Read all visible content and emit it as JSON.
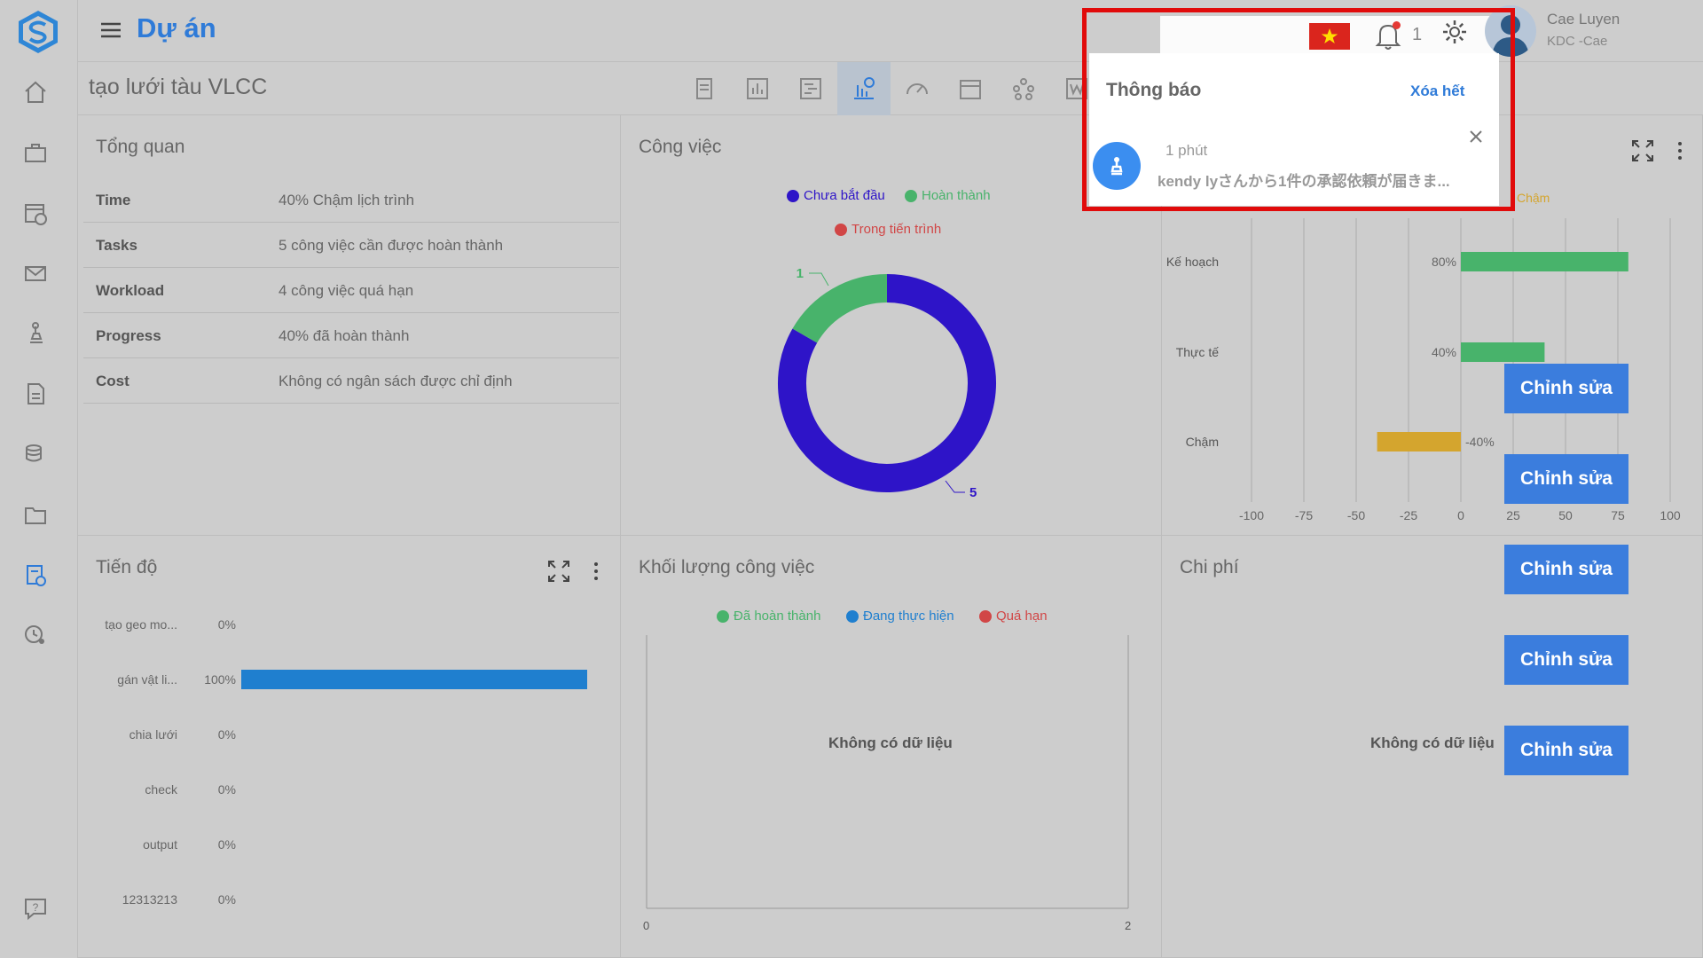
{
  "header": {
    "title": "Dự án",
    "notification_count": "1",
    "user_name": "Cae Luyen",
    "user_org": "KDC -Cae"
  },
  "project": {
    "name": "tạo lưới tàu VLCC"
  },
  "overview": {
    "title": "Tổng quan",
    "rows": [
      {
        "label": "Time",
        "value": "40% Chậm lịch trình"
      },
      {
        "label": "Tasks",
        "value": "5 công việc cần được hoàn thành"
      },
      {
        "label": "Workload",
        "value": "4 công việc quá hạn"
      },
      {
        "label": "Progress",
        "value": "40% đã hoàn thành"
      },
      {
        "label": "Cost",
        "value": "Không có ngân sách được chỉ định"
      }
    ]
  },
  "tasks_panel": {
    "title": "Công việc",
    "legend": [
      "Chưa bắt đầu",
      "Hoàn thành",
      "Trong tiến trình"
    ],
    "label_done": "1",
    "label_not_started": "5"
  },
  "time_panel": {
    "legend_delay": "Chậm",
    "categories": [
      "Kế hoạch",
      "Thực tế",
      "Chậm"
    ],
    "value_labels": [
      "80%",
      "40%",
      "-40%"
    ],
    "ticks": [
      "-100",
      "-75",
      "-50",
      "-25",
      "0",
      "25",
      "50",
      "75",
      "100"
    ]
  },
  "progress_panel": {
    "title": "Tiến độ",
    "tasks": [
      {
        "name": "tạo geo mo...",
        "pct": "0%"
      },
      {
        "name": "gán vật li...",
        "pct": "100%"
      },
      {
        "name": "chia lưới",
        "pct": "0%"
      },
      {
        "name": "check",
        "pct": "0%"
      },
      {
        "name": "output",
        "pct": "0%"
      },
      {
        "name": "12313213",
        "pct": "0%"
      }
    ]
  },
  "workload_panel": {
    "title": "Khối lượng công việc",
    "legend": [
      "Đã hoàn thành",
      "Đang thực hiện",
      "Quá hạn"
    ],
    "no_data": "Không có dữ liệu",
    "x_min": "0",
    "x_max": "2"
  },
  "cost_panel": {
    "title": "Chi phí",
    "no_data": "Không có dữ liệu"
  },
  "edit_buttons": [
    "Chỉnh sửa",
    "Chỉnh sửa",
    "Chỉnh sửa",
    "Chỉnh sửa",
    "Chỉnh sửa"
  ],
  "notification": {
    "title": "Thông báo",
    "clear_all": "Xóa hết",
    "time": "1 phút",
    "text": "kendy lyさんから1件の承認依頼が届きま..."
  },
  "chart_data": [
    {
      "type": "pie",
      "title": "Công việc",
      "categories": [
        "Chưa bắt đầu",
        "Hoàn thành",
        "Trong tiến trình"
      ],
      "values": [
        5,
        1,
        0
      ],
      "colors": [
        "#2e14c8",
        "#48b36b",
        "#d14646"
      ]
    },
    {
      "type": "bar",
      "orientation": "horizontal",
      "categories": [
        "Kế hoạch",
        "Thực tế",
        "Chậm"
      ],
      "values": [
        80,
        40,
        -40
      ],
      "xlim": [
        -100,
        100
      ],
      "colors": [
        "#48b36b",
        "#48b36b",
        "#d4a52e"
      ]
    },
    {
      "type": "bar",
      "orientation": "horizontal",
      "title": "Tiến độ",
      "categories": [
        "tạo geo mo...",
        "gán vật li...",
        "chia lưới",
        "check",
        "output",
        "12313213"
      ],
      "values": [
        0,
        100,
        0,
        0,
        0,
        0
      ],
      "xlim": [
        0,
        100
      ],
      "color": "#1f7fcf"
    }
  ],
  "colors": {
    "accent": "#2f7bd8",
    "button": "#3b7ddd",
    "highlight_frame": "#e10b0b"
  }
}
